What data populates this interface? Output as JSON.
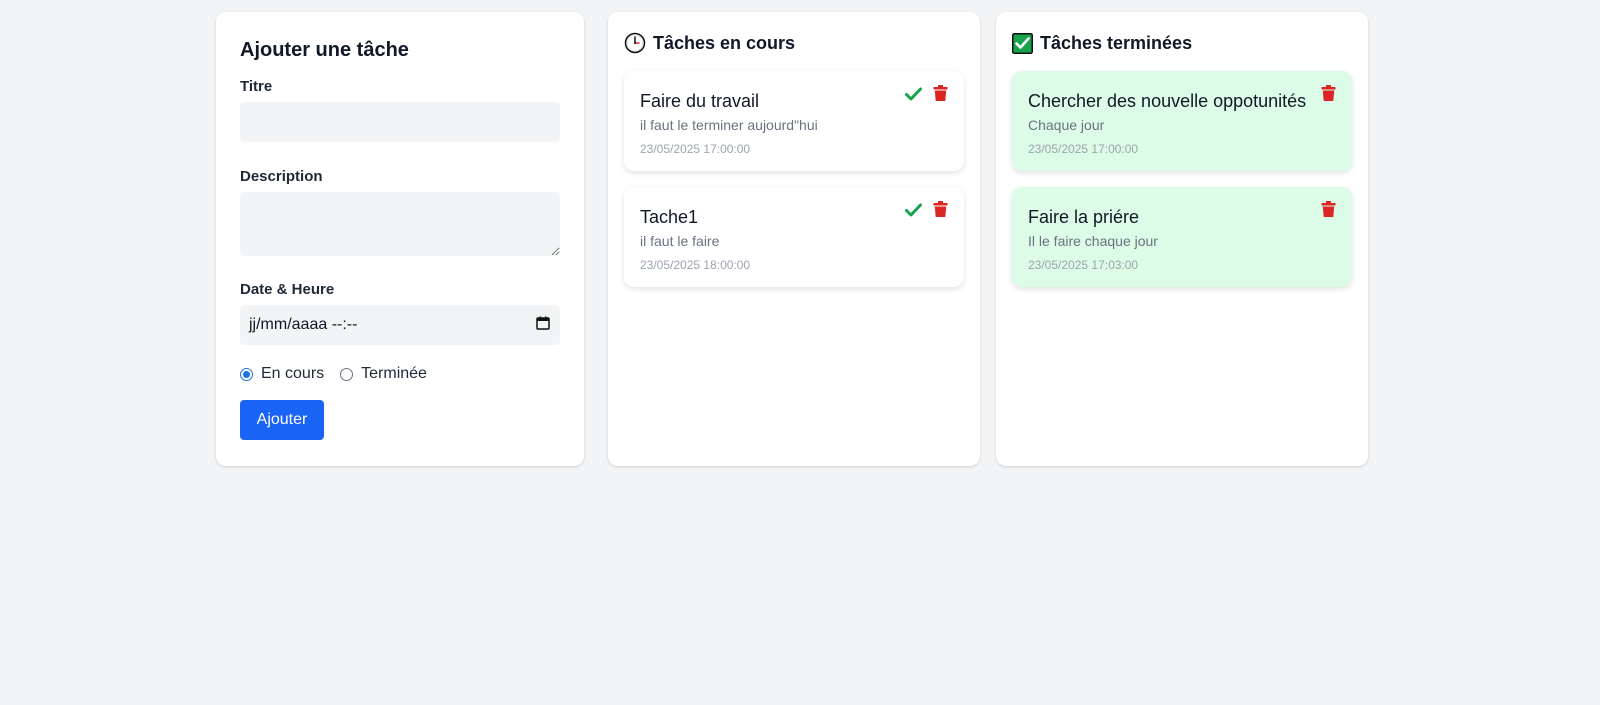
{
  "colors": {
    "page_bg": "#f3f4f6",
    "accent": "#1963f5",
    "check": "#16a34a",
    "trash": "#dc2626",
    "done_card_bg": "#dcfce7"
  },
  "form": {
    "title": "Ajouter une tâche",
    "title_label": "Titre",
    "title_value": "",
    "description_label": "Description",
    "description_value": "",
    "datetime_label": "Date & Heure",
    "datetime_placeholder": "jj/mm/aaaa --:--",
    "status_options": [
      {
        "label": "En cours",
        "selected": true
      },
      {
        "label": "Terminée",
        "selected": false
      }
    ],
    "submit_label": "Ajouter"
  },
  "in_progress": {
    "icon": "clock-icon",
    "title": "Tâches en cours",
    "tasks": [
      {
        "title": "Faire du travail",
        "description": "il faut le terminer aujourd\"hui",
        "date": "23/05/2025 17:00:00"
      },
      {
        "title": "Tache1",
        "description": "il faut le faire",
        "date": "23/05/2025 18:00:00"
      }
    ]
  },
  "completed": {
    "icon": "checkbox-checked-icon",
    "title": "Tâches terminées",
    "tasks": [
      {
        "title": "Chercher des nouvelle oppotunités",
        "description": "Chaque jour",
        "date": "23/05/2025 17:00:00"
      },
      {
        "title": "Faire la priére",
        "description": "Il le faire chaque jour",
        "date": "23/05/2025 17:03:00"
      }
    ]
  }
}
